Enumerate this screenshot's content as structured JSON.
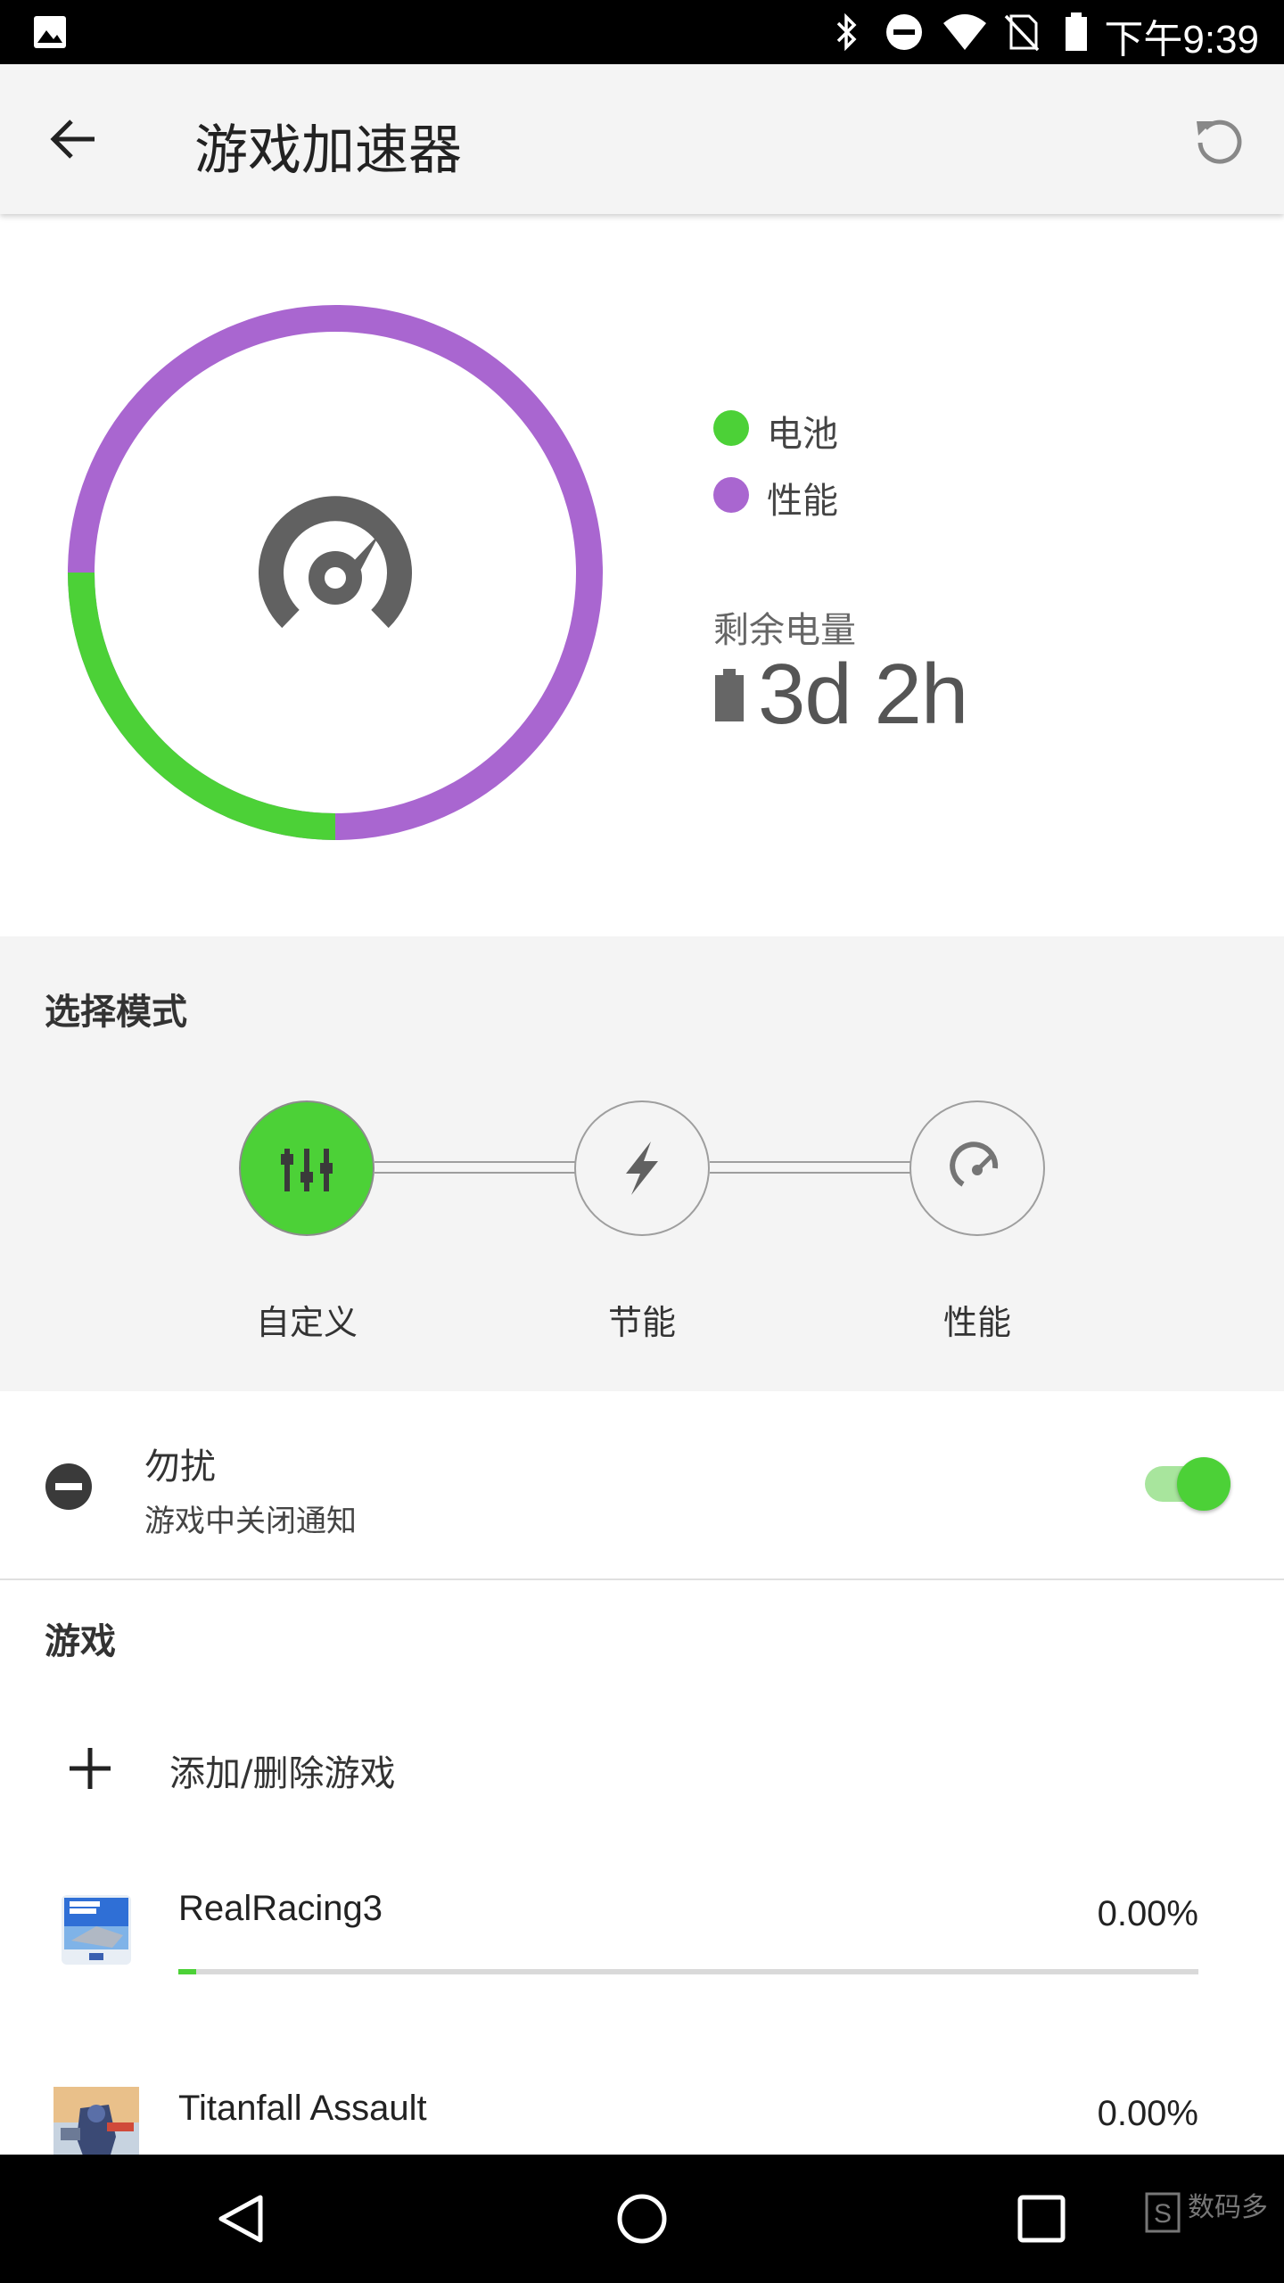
{
  "status_bar": {
    "time": "下午9:39",
    "icons": [
      "image-icon",
      "bluetooth-icon",
      "dnd-icon",
      "wifi-icon",
      "no-sim-icon",
      "battery-icon"
    ]
  },
  "app_bar": {
    "title": "游戏加速器",
    "back_icon": "arrow-back-icon",
    "reset_icon": "refresh-icon"
  },
  "summary": {
    "gauge_icon": "speedometer-icon",
    "battery_share": 0.25,
    "performance_share": 0.75,
    "legend": [
      {
        "label": "电池",
        "color": "#4cd137"
      },
      {
        "label": "性能",
        "color": "#a966d0"
      }
    ],
    "remaining_label": "剩余电量",
    "remaining_value": "3d 2h"
  },
  "mode": {
    "section_title": "选择模式",
    "options": [
      {
        "label": "自定义",
        "icon": "sliders-icon",
        "active": true
      },
      {
        "label": "节能",
        "icon": "bolt-icon",
        "active": false
      },
      {
        "label": "性能",
        "icon": "speedometer-icon",
        "active": false
      }
    ],
    "active_color": "#4cd137"
  },
  "dnd": {
    "title": "勿扰",
    "subtitle": "游戏中关闭通知",
    "enabled": true
  },
  "games": {
    "section_title": "游戏",
    "add_label": "添加/删除游戏",
    "items": [
      {
        "name": "RealRacing3",
        "percent": "0.00%",
        "progress": 0.0
      },
      {
        "name": "Titanfall Assault",
        "percent": "0.00%",
        "progress": 0.0
      }
    ]
  },
  "nav_bar": {
    "icons": [
      "back-triangle-icon",
      "home-circle-icon",
      "recents-square-icon"
    ],
    "watermark": "数码多"
  }
}
